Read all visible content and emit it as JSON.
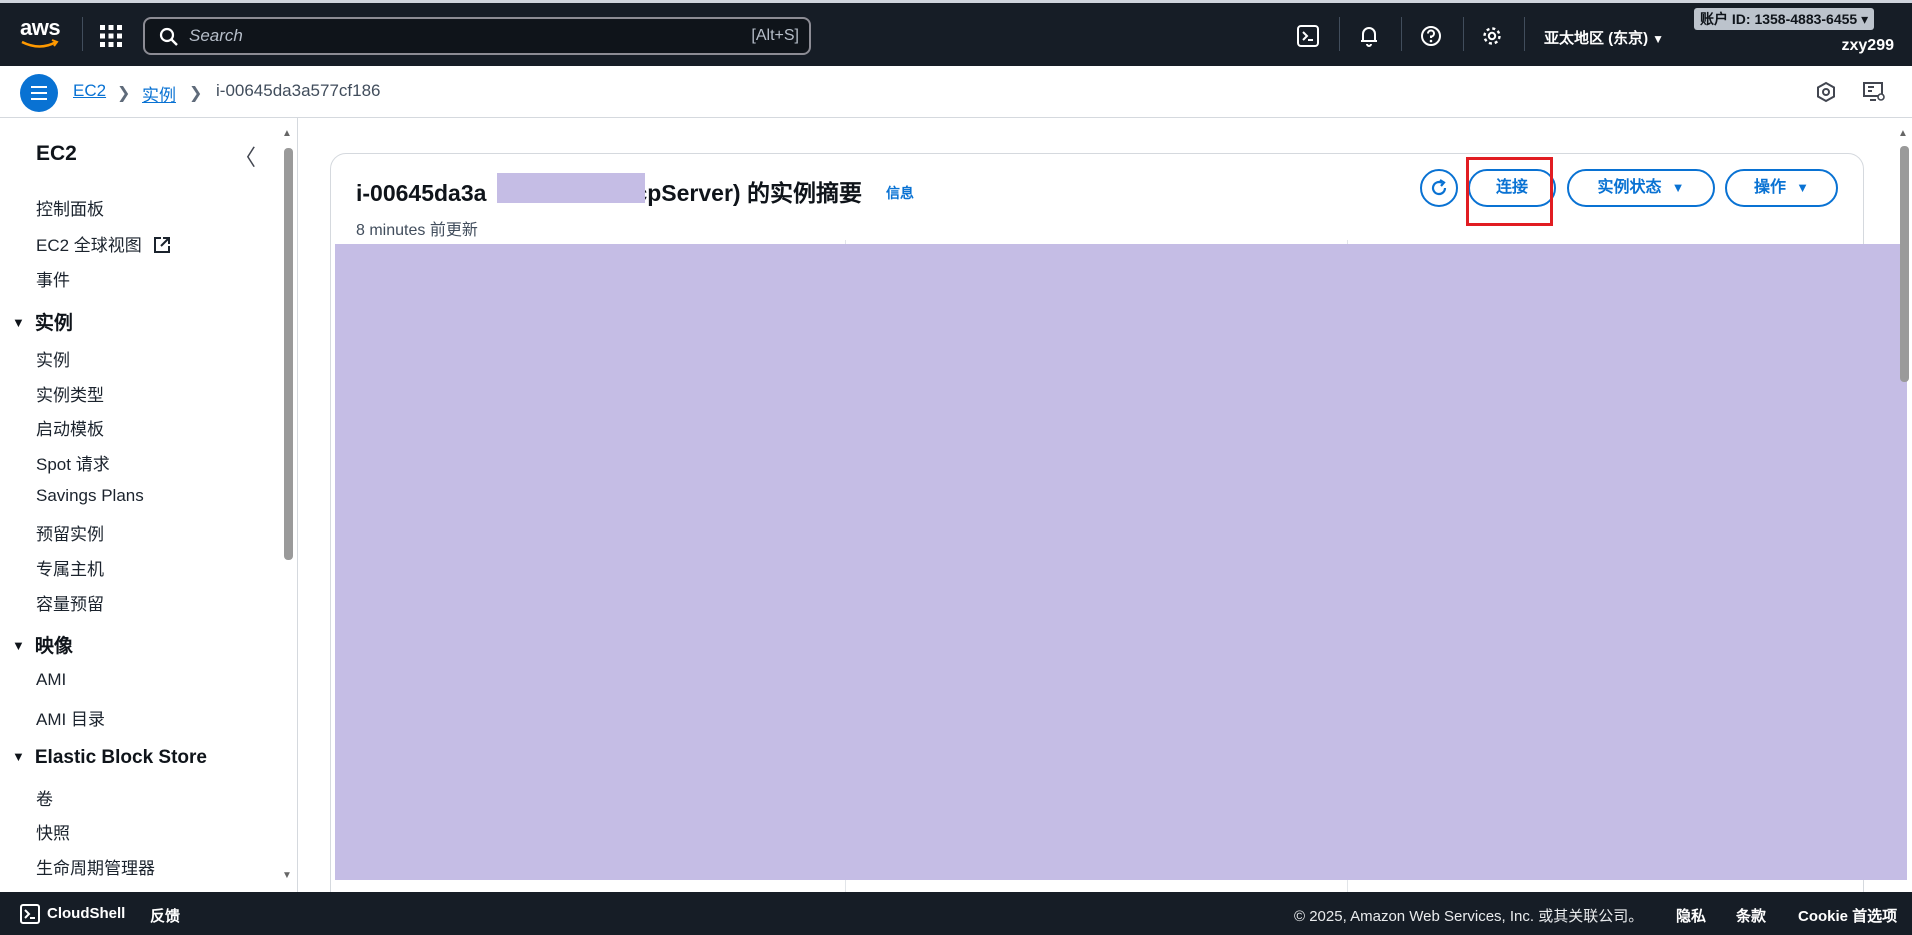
{
  "topnav": {
    "logo_text": "aws",
    "search_placeholder": "Search",
    "search_shortcut": "[Alt+S]",
    "region": "亚太地区 (东京)",
    "account_badge": "账户 ID: 1358-4883-6455 ▾",
    "username": "zxy299",
    "icons": [
      "services-grid-icon",
      "cloudshell-icon",
      "bell-icon",
      "help-icon",
      "gear-icon"
    ]
  },
  "breadcrumb": {
    "items": [
      "EC2",
      "实例",
      "i-00645da3a577cf186"
    ]
  },
  "sidebar": {
    "title": "EC2",
    "top_items": [
      "控制面板",
      "EC2 全球视图",
      "事件"
    ],
    "sections": [
      {
        "label": "实例",
        "items": [
          "实例",
          "实例类型",
          "启动模板",
          "Spot 请求",
          "Savings Plans",
          "预留实例",
          "专属主机",
          "容量预留"
        ]
      },
      {
        "label": "映像",
        "items": [
          "AMI",
          "AMI 目录"
        ]
      },
      {
        "label": "Elastic Block Store",
        "items": [
          "卷",
          "快照",
          "生命周期管理器"
        ]
      }
    ]
  },
  "summary": {
    "title_prefix": "i-00645da3a",
    "title_suffix": "cpServer) 的实例摘要",
    "info": "信息",
    "updated": "8 minutes 前更新",
    "connect_label": "连接",
    "state_label": "实例状态",
    "actions_label": "操作"
  },
  "footer": {
    "cloudshell": "CloudShell",
    "feedback": "反馈",
    "copyright": "© 2025, Amazon Web Services, Inc. 或其关联公司。",
    "privacy": "隐私",
    "terms": "条款",
    "cookie": "Cookie 首选项"
  }
}
